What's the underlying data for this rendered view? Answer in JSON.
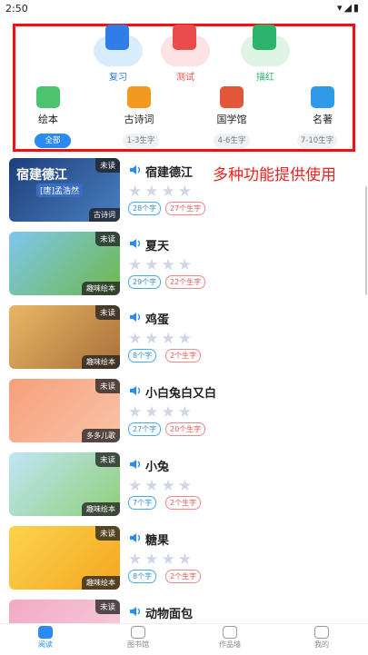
{
  "status_bar": {
    "time": "2:50",
    "icons": "▾◢▮"
  },
  "modes": [
    {
      "label": "复习",
      "color": "#2f7ee8",
      "bubble": "#d9ecfb",
      "icon": "person-card-icon"
    },
    {
      "label": "测试",
      "color": "#ea4c4c",
      "bubble": "#fde3e3",
      "icon": "test-icon"
    },
    {
      "label": "描红",
      "color": "#2cb56a",
      "bubble": "#def5e6",
      "icon": "trace-pen-icon"
    }
  ],
  "categories": [
    {
      "label": "绘本",
      "color": "#4cc36e",
      "icon": "picture-book-icon"
    },
    {
      "label": "古诗词",
      "color": "#f39a1e",
      "icon": "poetry-book-icon"
    },
    {
      "label": "国学馆",
      "color": "#e2573a",
      "icon": "classics-scroll-icon"
    },
    {
      "label": "名著",
      "color": "#2f9be8",
      "icon": "masterpiece-book-icon"
    }
  ],
  "levels": [
    "全部",
    "1-3生字",
    "4-6生字",
    "7-10生字"
  ],
  "headline": "多种功能提供使用",
  "books": [
    {
      "title": "宿建德江",
      "words": "28个字",
      "chars": "27个生字",
      "tag": "古诗词",
      "unread": "未读",
      "cover_title": "宿建德江",
      "cover_sub": "[唐]孟浩然",
      "bg1": "#1d3f7a",
      "bg2": "#4a7fc0"
    },
    {
      "title": "夏天",
      "words": "29个字",
      "chars": "22个生字",
      "tag": "趣味绘本",
      "unread": "未读",
      "bg1": "#7ec7f0",
      "bg2": "#6fb84a"
    },
    {
      "title": "鸡蛋",
      "words": "8个字",
      "chars": "2个生字",
      "tag": "趣味绘本",
      "unread": "未读",
      "bg1": "#e8b765",
      "bg2": "#a9703a"
    },
    {
      "title": "小白兔白又白",
      "words": "27个字",
      "chars": "20个生字",
      "tag": "多多儿歌",
      "unread": "未读",
      "bg1": "#f7a07a",
      "bg2": "#f8c3a8"
    },
    {
      "title": "小兔",
      "words": "7个字",
      "chars": "2个生字",
      "tag": "趣味绘本",
      "unread": "未读",
      "bg1": "#bfe6f7",
      "bg2": "#8fcf78"
    },
    {
      "title": "糖果",
      "words": "8个字",
      "chars": "2个生字",
      "tag": "趣味绘本",
      "unread": "未读",
      "bg1": "#fbd44a",
      "bg2": "#f5a623"
    },
    {
      "title": "动物面包",
      "unread": "未读",
      "bg1": "#f2a9c4",
      "bg2": "#f7d0de"
    }
  ],
  "nav": [
    {
      "label": "阅读",
      "active": true
    },
    {
      "label": "图书馆",
      "active": false
    },
    {
      "label": "作品墙",
      "active": false
    },
    {
      "label": "我的",
      "active": false
    }
  ]
}
